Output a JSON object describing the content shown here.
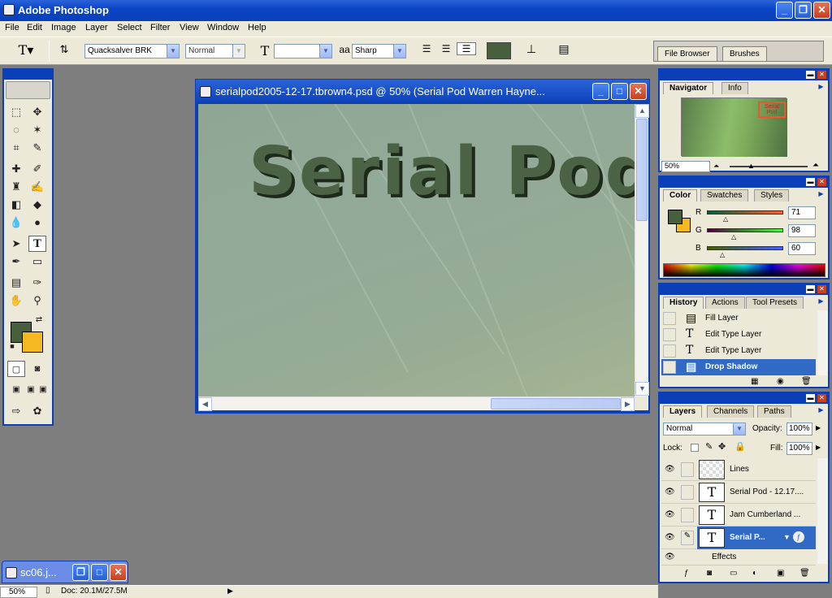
{
  "app": {
    "title": "Adobe Photoshop"
  },
  "menu": [
    "File",
    "Edit",
    "Image",
    "Layer",
    "Select",
    "Filter",
    "View",
    "Window",
    "Help"
  ],
  "options": {
    "font_family": "Quacksalver BRK",
    "font_style": "Normal",
    "font_size": "",
    "aa_label": "a",
    "antialias": "Sharp",
    "text_color": "#475F3C"
  },
  "palette_well": {
    "tabs": [
      "File Browser",
      "Brushes"
    ]
  },
  "toolbox": {
    "fg_color": "#475F3C",
    "bg_color": "#F5B820"
  },
  "document": {
    "title": "serialpod2005-12-17.tbrown4.psd @ 50% (Serial Pod     Warren Hayne...",
    "canvas_text": "Serial Pod"
  },
  "navigator": {
    "tabs": [
      "Navigator",
      "Info"
    ],
    "zoom": "50%",
    "thumb_text": "Serial Pod"
  },
  "color": {
    "tabs": [
      "Color",
      "Swatches",
      "Styles"
    ],
    "channels": [
      {
        "label": "R",
        "value": "71"
      },
      {
        "label": "G",
        "value": "98"
      },
      {
        "label": "B",
        "value": "60"
      }
    ]
  },
  "history": {
    "tabs": [
      "History",
      "Actions",
      "Tool Presets"
    ],
    "items": [
      {
        "label": "Fill Layer",
        "icon": "layer-icon"
      },
      {
        "label": "Edit Type Layer",
        "icon": "type-icon"
      },
      {
        "label": "Edit Type Layer",
        "icon": "type-icon"
      },
      {
        "label": "Drop Shadow",
        "icon": "layer-icon"
      }
    ]
  },
  "layers": {
    "tabs": [
      "Layers",
      "Channels",
      "Paths"
    ],
    "blend_mode": "Normal",
    "opacity_label": "Opacity:",
    "opacity": "100%",
    "lock_label": "Lock:",
    "fill_label": "Fill:",
    "fill": "100%",
    "items": [
      {
        "name": "Lines",
        "thumb": ""
      },
      {
        "name": "Serial Pod - 12.17....",
        "thumb": "T"
      },
      {
        "name": "Jam  Cumberland ...",
        "thumb": "T"
      },
      {
        "name": "Serial P...",
        "thumb": "T"
      }
    ],
    "effects_label": "Effects"
  },
  "minimized": {
    "title": "sc06.j..."
  },
  "status": {
    "zoom": "50%",
    "doc": "Doc: 20.1M/27.5M"
  }
}
